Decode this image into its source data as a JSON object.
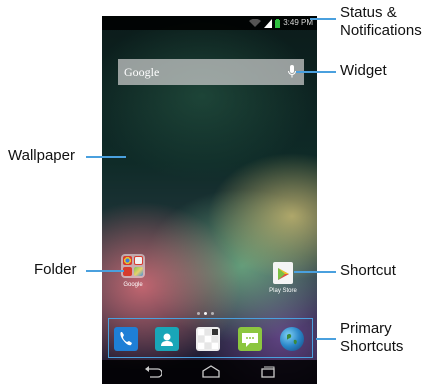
{
  "status": {
    "time": "3:49 PM"
  },
  "search": {
    "logo_text": "Google"
  },
  "folder": {
    "label": "Google"
  },
  "shortcut": {
    "label": "Play Store"
  },
  "dock": {
    "apps": [
      "phone-icon",
      "contacts-icon",
      "apps-icon",
      "messaging-icon",
      "browser-icon"
    ]
  },
  "callouts": {
    "status_line1": "Status &",
    "status_line2": "Notifications",
    "widget": "Widget",
    "wallpaper": "Wallpaper",
    "folder": "Folder",
    "shortcut": "Shortcut",
    "primary_line1": "Primary",
    "primary_line2": "Shortcuts"
  },
  "colors": {
    "callout_line": "#4aa0de"
  }
}
